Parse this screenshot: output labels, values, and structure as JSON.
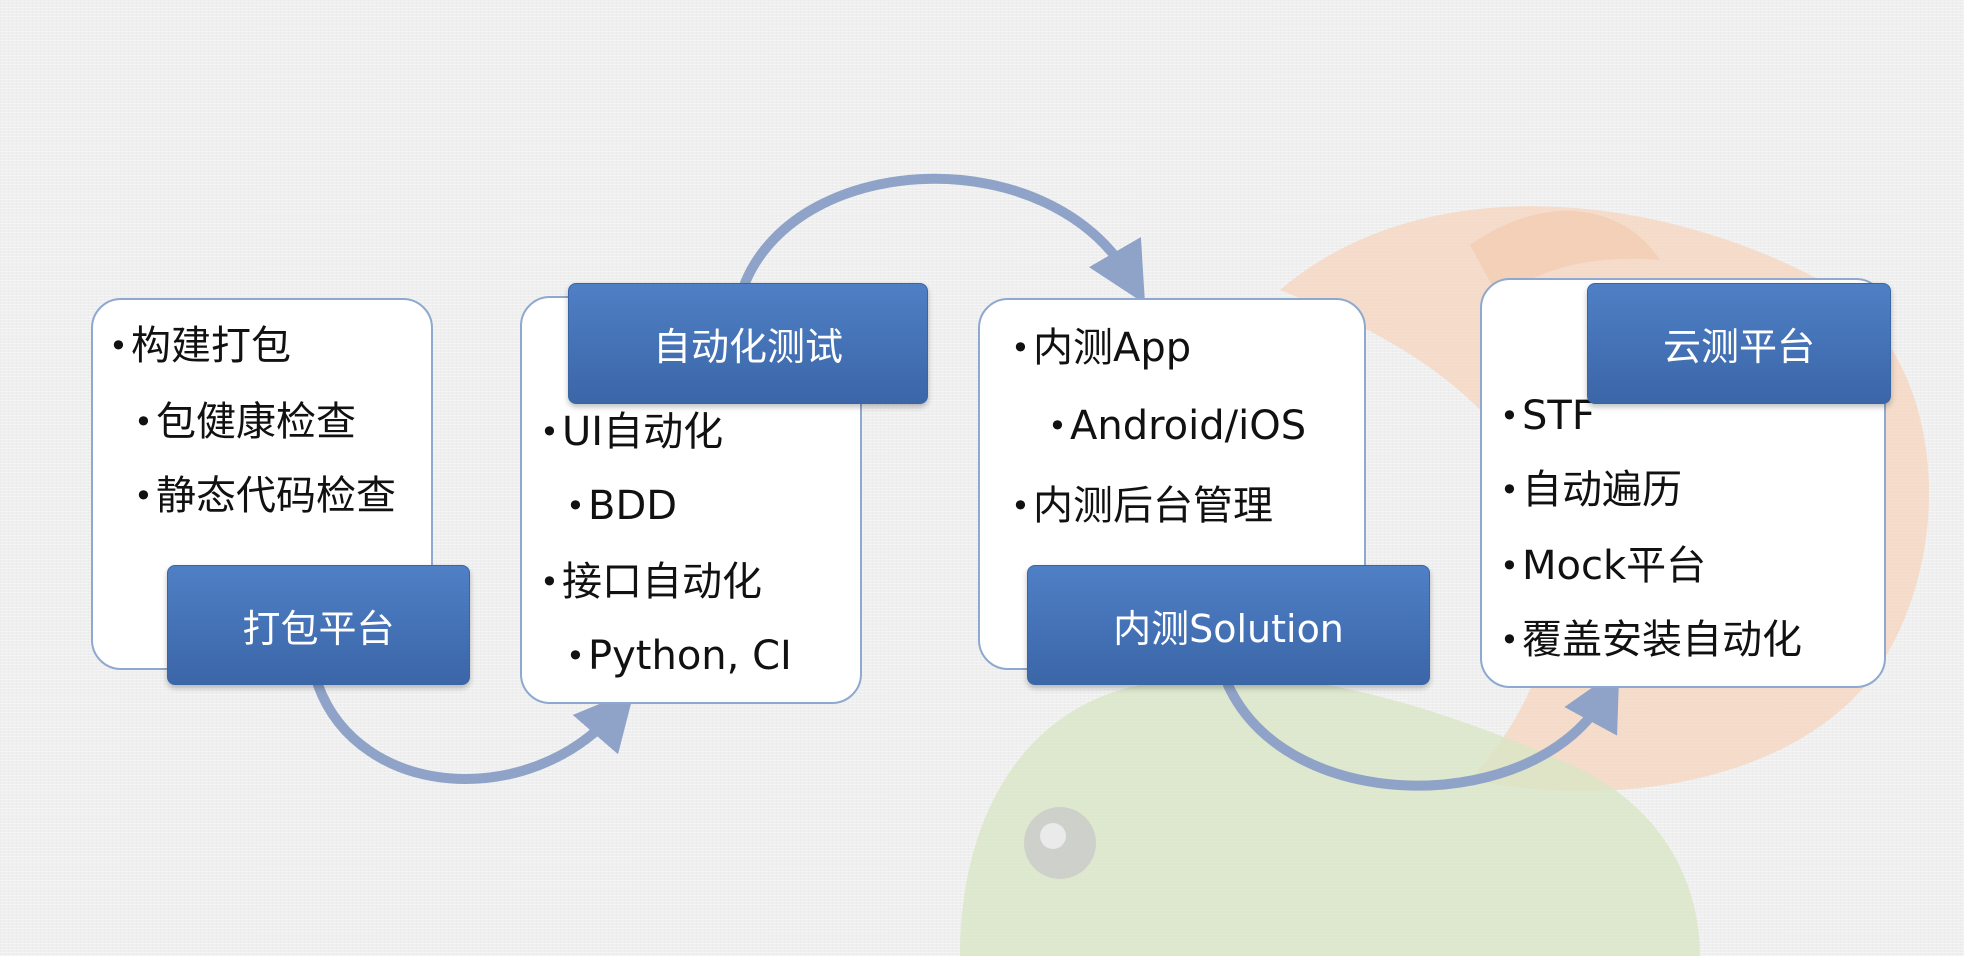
{
  "stages": [
    {
      "title": "打包平台",
      "items": [
        {
          "label": "构建打包",
          "level": 1
        },
        {
          "label": "包健康检查",
          "level": 2
        },
        {
          "label": "静态代码检查",
          "level": 2
        }
      ]
    },
    {
      "title": "自动化测试",
      "items": [
        {
          "label": "UI自动化",
          "level": 1
        },
        {
          "label": "BDD",
          "level": 2
        },
        {
          "label": "接口自动化",
          "level": 1
        },
        {
          "label": "Python, CI",
          "level": 2
        }
      ]
    },
    {
      "title": "内测Solution",
      "items": [
        {
          "label": "内测App",
          "level": 1
        },
        {
          "label": "Android/iOS",
          "level": 2
        },
        {
          "label": "内测后台管理",
          "level": 1
        }
      ]
    },
    {
      "title": "云测平台",
      "items": [
        {
          "label": "STF",
          "level": 1
        },
        {
          "label": "自动遍历",
          "level": 1
        },
        {
          "label": "Mock平台",
          "level": 1
        },
        {
          "label": "覆盖安装自动化",
          "level": 1
        }
      ]
    }
  ],
  "colors": {
    "title_fill": "#4a78bd",
    "card_border": "#8ea8cf",
    "arrow": "#8fa3c8",
    "bg_orange": "#f6d4bd",
    "bg_green": "#d9e6c6"
  }
}
